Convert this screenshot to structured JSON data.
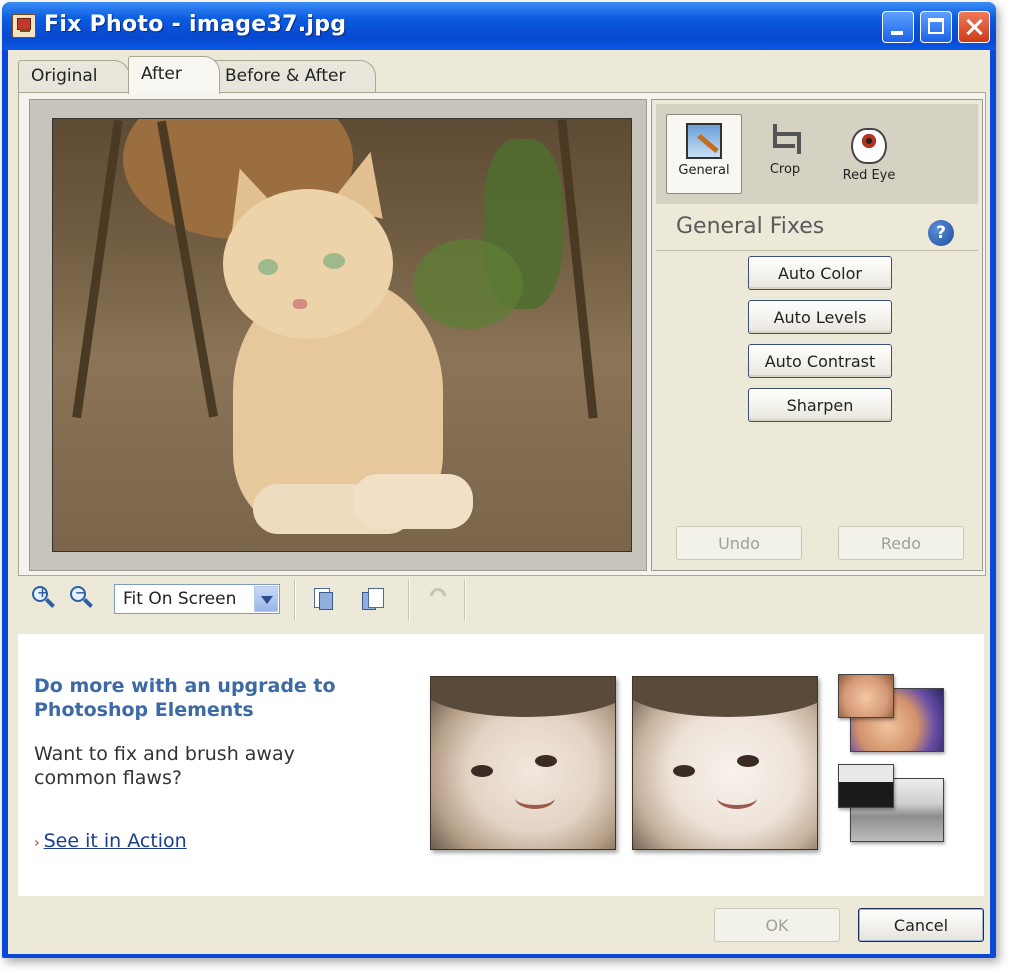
{
  "window": {
    "title": "Fix Photo - image37.jpg"
  },
  "tabs": [
    {
      "label": "Original"
    },
    {
      "label": "After"
    },
    {
      "label": "Before & After"
    }
  ],
  "tools": [
    {
      "label": "General",
      "icon": "general-fix-icon"
    },
    {
      "label": "Crop",
      "icon": "crop-icon"
    },
    {
      "label": "Red Eye",
      "icon": "red-eye-icon"
    }
  ],
  "fix_panel": {
    "title": "General Fixes",
    "help_label": "?",
    "buttons": [
      {
        "label": "Auto Color"
      },
      {
        "label": "Auto Levels"
      },
      {
        "label": "Auto Contrast"
      },
      {
        "label": "Sharpen"
      }
    ],
    "undo_label": "Undo",
    "redo_label": "Redo"
  },
  "toolbar": {
    "zoom_value": "Fit On Screen",
    "icons": [
      "zoom-in-icon",
      "zoom-out-icon",
      "rotate-left-icon",
      "rotate-right-icon",
      "undo-icon"
    ]
  },
  "promo": {
    "title": "Do more with an upgrade to Photoshop Elements",
    "text": "Want to fix and brush away common flaws?",
    "link_chevron": "›",
    "link_label": "See it in Action"
  },
  "footer": {
    "ok_label": "OK",
    "cancel_label": "Cancel"
  },
  "colors": {
    "titlebar": "#0a58e6",
    "promo_title": "#3d6aa5",
    "link": "#1a3d8f"
  }
}
